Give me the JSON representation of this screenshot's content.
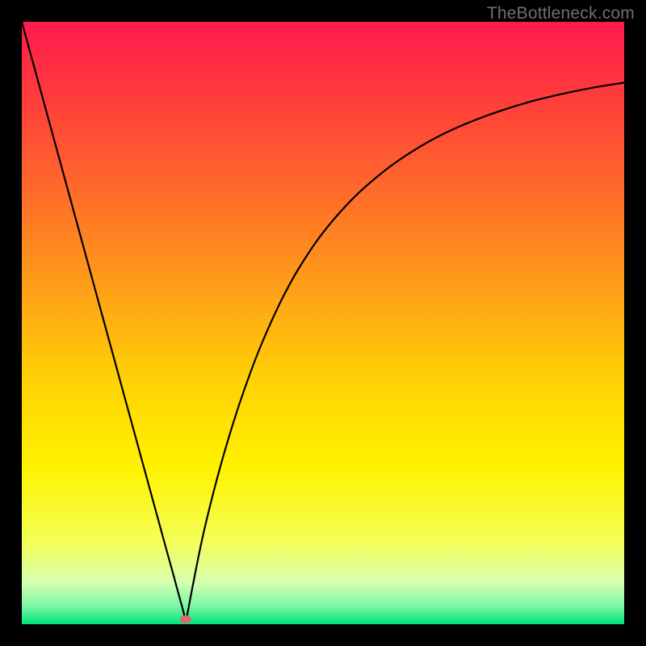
{
  "watermark": "TheBottleneck.com",
  "chart_data": {
    "type": "line",
    "title": "",
    "xlabel": "",
    "ylabel": "",
    "xlim": [
      0,
      100
    ],
    "ylim": [
      0,
      100
    ],
    "grid": false,
    "legend": false,
    "background_gradient": {
      "stops": [
        {
          "offset": 0.0,
          "color": "#ff1a4d"
        },
        {
          "offset": 0.12,
          "color": "#ff3b3c"
        },
        {
          "offset": 0.28,
          "color": "#ff6a2a"
        },
        {
          "offset": 0.45,
          "color": "#ffa217"
        },
        {
          "offset": 0.6,
          "color": "#ffd305"
        },
        {
          "offset": 0.74,
          "color": "#fff200"
        },
        {
          "offset": 0.86,
          "color": "#f5ff55"
        },
        {
          "offset": 0.93,
          "color": "#d7ffb0"
        },
        {
          "offset": 0.97,
          "color": "#7cf7a5"
        },
        {
          "offset": 1.0,
          "color": "#00e37a"
        }
      ]
    },
    "marker": {
      "x": 27.2,
      "y": 0.8,
      "color": "#d86a6a"
    },
    "series": [
      {
        "name": "curve",
        "x": [
          0,
          2,
          4,
          6,
          8,
          10,
          12,
          14,
          16,
          18,
          20,
          22,
          24,
          25,
          26,
          26.8,
          27.2,
          27.6,
          28.4,
          30,
          32,
          34,
          36,
          38,
          40,
          43,
          46,
          50,
          55,
          60,
          65,
          70,
          75,
          80,
          85,
          90,
          95,
          100
        ],
        "y": [
          100,
          92.7,
          85.4,
          78.1,
          70.8,
          63.5,
          56.2,
          48.9,
          41.6,
          34.3,
          27.0,
          19.7,
          12.4,
          8.8,
          5.1,
          2.2,
          0.7,
          2.3,
          6.5,
          14.4,
          22.6,
          29.8,
          36.2,
          41.9,
          47.0,
          53.6,
          59.1,
          65.0,
          70.7,
          75.1,
          78.6,
          81.4,
          83.6,
          85.4,
          86.9,
          88.1,
          89.1,
          89.9
        ]
      }
    ]
  }
}
